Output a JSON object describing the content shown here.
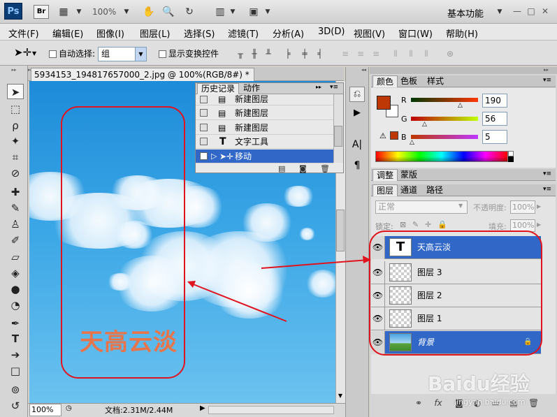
{
  "app": {
    "logo": "Ps",
    "bridge": "Br",
    "zoom": "100%",
    "workspace": "基本功能",
    "min_btn": "—",
    "restore_btn": "□",
    "close_btn": "✕"
  },
  "menu": [
    "文件(F)",
    "编辑(E)",
    "图像(I)",
    "图层(L)",
    "选择(S)",
    "滤镜(T)",
    "分析(A)",
    "3D(D)",
    "视图(V)",
    "窗口(W)",
    "帮助(H)"
  ],
  "options": {
    "auto_select_label": "自动选择:",
    "auto_select_value": "组",
    "show_transform_label": "显示变换控件"
  },
  "document": {
    "tab_title": "5934153_194817657000_2.jpg @ 100%(RGB/8#) *",
    "tab_close": "×",
    "canvas_text": "天高云淡",
    "text_color": "#e8744a",
    "status_zoom": "100%",
    "status_doc": "文档:2.31M/2.44M"
  },
  "history": {
    "tabs": [
      "历史记录",
      "动作"
    ],
    "rows": [
      {
        "label": "新建图层",
        "icon": "doc"
      },
      {
        "label": "新建图层",
        "icon": "doc"
      },
      {
        "label": "新建图层",
        "icon": "doc"
      },
      {
        "label": "文字工具",
        "icon": "T"
      },
      {
        "label": "移动",
        "icon": "move",
        "selected": true
      }
    ]
  },
  "color_panel": {
    "tabs": [
      "颜色",
      "色板",
      "样式"
    ],
    "r_label": "R",
    "g_label": "G",
    "b_label": "B",
    "r": "190",
    "g": "56",
    "b": "5",
    "foreground": "#be3805",
    "background": "#ffffff"
  },
  "adjust_panel": {
    "tabs": [
      "调整",
      "蒙版"
    ]
  },
  "layers_panel": {
    "tabs": [
      "图层",
      "通道",
      "路径"
    ],
    "blend_mode": "正常",
    "opacity_label": "不透明度:",
    "opacity": "100%",
    "lock_label": "锁定:",
    "fill_label": "填充:",
    "fill": "100%",
    "layers": [
      {
        "name": "天高云淡",
        "type": "text",
        "selected": true
      },
      {
        "name": "图层 3",
        "type": "empty"
      },
      {
        "name": "图层 2",
        "type": "empty"
      },
      {
        "name": "图层 1",
        "type": "empty"
      },
      {
        "name": "背景",
        "type": "image",
        "selected": true,
        "locked": true
      }
    ]
  },
  "annotations": {
    "highlight_color": "#e0141e"
  },
  "watermark": {
    "text": "Baidu经验",
    "sub": "jingyan.baidu.com"
  }
}
